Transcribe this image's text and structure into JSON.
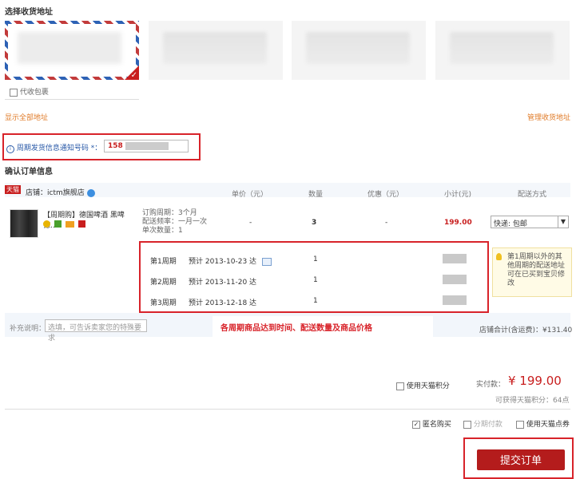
{
  "address": {
    "title": "选择收货地址",
    "proxy_label": "代收包裹",
    "show_all": "显示全部地址",
    "manage": "管理收货地址"
  },
  "notify": {
    "label": "周期发货信息通知号码 *：",
    "value": "158"
  },
  "order": {
    "title": "确认订单信息",
    "shop_badge": "天猫",
    "shop_name": "店铺：ictm旗舰店",
    "columns": [
      "单价（元）",
      "数量",
      "优惠（元）",
      "小计(元)",
      "配送方式"
    ],
    "product": {
      "name": "【周期购】德国啤酒 黑啤 德...",
      "info": [
        "订购周期：3个月",
        "配送频率：一月一次",
        "单次数量：1"
      ],
      "unit_price": "-",
      "quantity": "3",
      "discount": "-",
      "subtotal": "199.00",
      "shipping": "快递: 包邮"
    },
    "cycles": [
      {
        "period": "第1周期",
        "estimate": "预计 2013-10-23 达",
        "qty": "1"
      },
      {
        "period": "第2周期",
        "estimate": "预计 2013-11-20 达",
        "qty": "1"
      },
      {
        "period": "第3周期",
        "estimate": "预计 2013-12-18 达",
        "qty": "1"
      }
    ],
    "tip": "第1周期以外的其他周期的配送地址可在已买到宝贝修改",
    "annotation": "各周期商品达到时间、配送数量及商品价格",
    "note_label": "补充说明：",
    "note_placeholder": "选填，可告诉卖家您的特殊要求",
    "shop_total": "店铺合计(含运费)：¥131.40"
  },
  "payment": {
    "use_points": "使用天猫积分",
    "actual_label": "实付款：",
    "actual_value": "¥ 199.00",
    "points_label": "可获得天猫积分：64点",
    "anonymous": "匿名购买",
    "installment": "分期付款",
    "coupon": "使用天猫点券",
    "submit": "提交订单"
  },
  "colors": {
    "accent_red": "#d8232a",
    "submit_bg": "#b41c1c",
    "link_orange": "#e07b28",
    "price_red": "#c81e1e"
  }
}
